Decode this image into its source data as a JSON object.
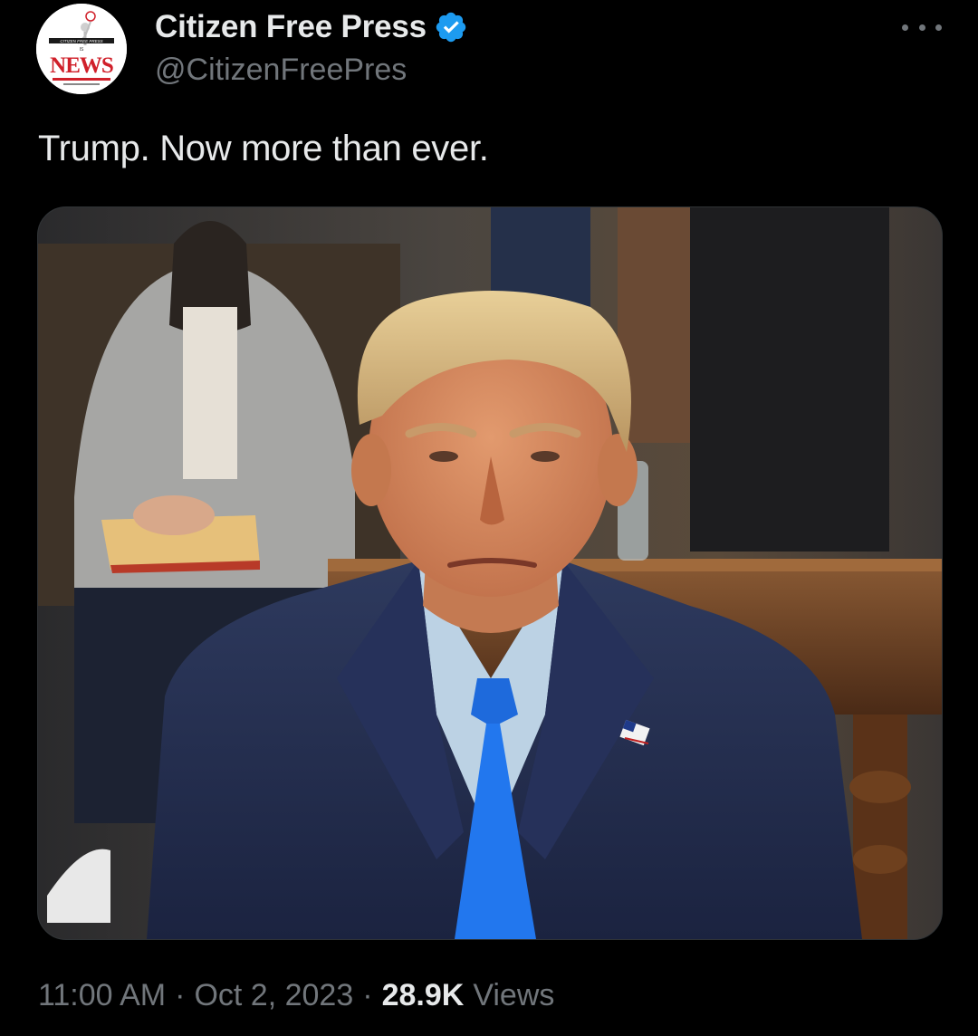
{
  "author": {
    "display_name": "Citizen Free Press",
    "handle": "@CitizenFreePres",
    "avatar_text_top": "CITIZEN FREE PRESS",
    "avatar_text_mid": "IS",
    "avatar_text_main": "NEWS",
    "verified_color": "#1d9bf0"
  },
  "tweet": {
    "text": "Trump. Now more than ever."
  },
  "meta": {
    "time": "11:00 AM",
    "separator": "·",
    "date": "Oct 2, 2023",
    "views_count": "28.9K",
    "views_label": "Views"
  },
  "icons": {
    "more": "more-horizontal-icon",
    "verified": "verified-badge-icon"
  },
  "colors": {
    "background": "#000000",
    "primary_text": "#e7e9ea",
    "secondary_text": "#71767b",
    "accent": "#1d9bf0"
  }
}
